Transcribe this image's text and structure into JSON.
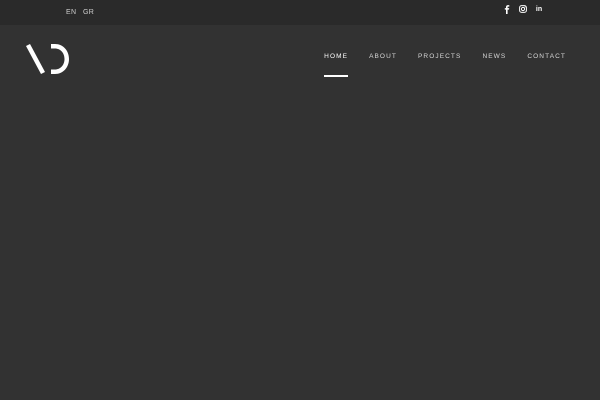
{
  "topbar": {
    "languages": [
      {
        "label": "EN"
      },
      {
        "label": "GR"
      }
    ],
    "social": [
      {
        "icon": "facebook-icon",
        "label": "f"
      },
      {
        "icon": "instagram-icon"
      },
      {
        "icon": "linkedin-icon",
        "label": "in"
      }
    ]
  },
  "logo": {
    "icon": "site-logo"
  },
  "nav": {
    "active": "HOME",
    "items": [
      {
        "label": "HOME"
      },
      {
        "label": "ABOUT"
      },
      {
        "label": "PROJECTS"
      },
      {
        "label": "NEWS"
      },
      {
        "label": "CONTACT"
      }
    ]
  },
  "colors": {
    "background": "#323232",
    "topbar": "#2a2a2a",
    "foreground": "#ffffff"
  }
}
